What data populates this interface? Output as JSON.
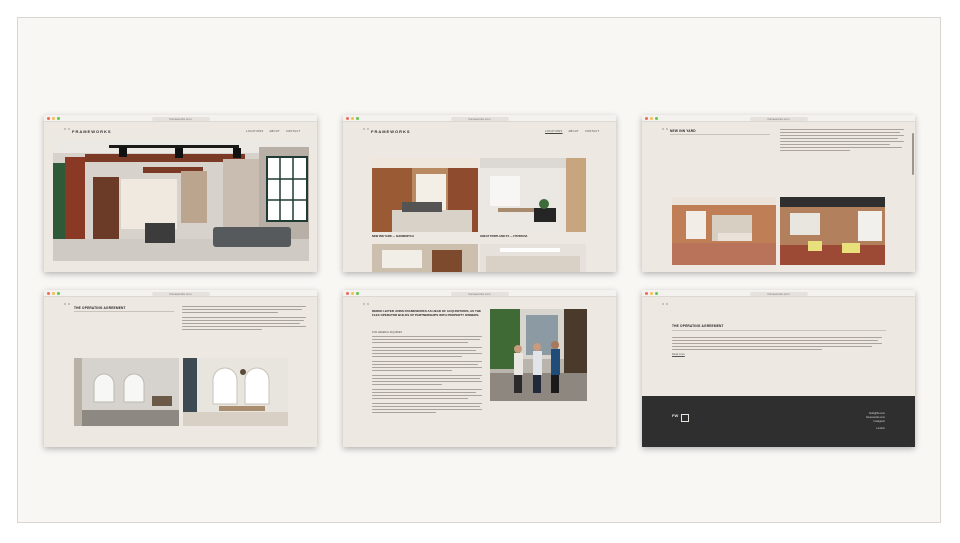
{
  "site": {
    "url": "frameworks.com",
    "logo": "FRAMEWORKS",
    "nav": [
      "Locations",
      "About",
      "Contact"
    ]
  },
  "project_captions": {
    "p1": "NEW INN YARD — SHOREDITCH",
    "p2": "GREAT PORTLAND ST — FITZROVIA"
  },
  "sections": {
    "location_title": "NEW INN YARD",
    "operating_title": "THE OPERATING AGREEMENT",
    "article_heading": "DEREK LEITER JOINS FRAMEWORKS AS HEAD OF ACQUISITIONS, AS THE FLEX OPERATOR BUILDS UP PARTNERSHIPS WITH PROPERTY OWNERS.",
    "article_sub": "FOR GENERAL INQUIRIES",
    "link_text": "Read more"
  },
  "footer": {
    "mark": "FW",
    "lines": [
      "hello@fw.com",
      "frameworks.com",
      "Instagram",
      "London"
    ]
  },
  "colors": {
    "board_bg": "#f9f7f4",
    "page_bg": "#eee8e2",
    "footer_bg": "#2f2f2f",
    "accent_green": "#2f5a3a"
  }
}
